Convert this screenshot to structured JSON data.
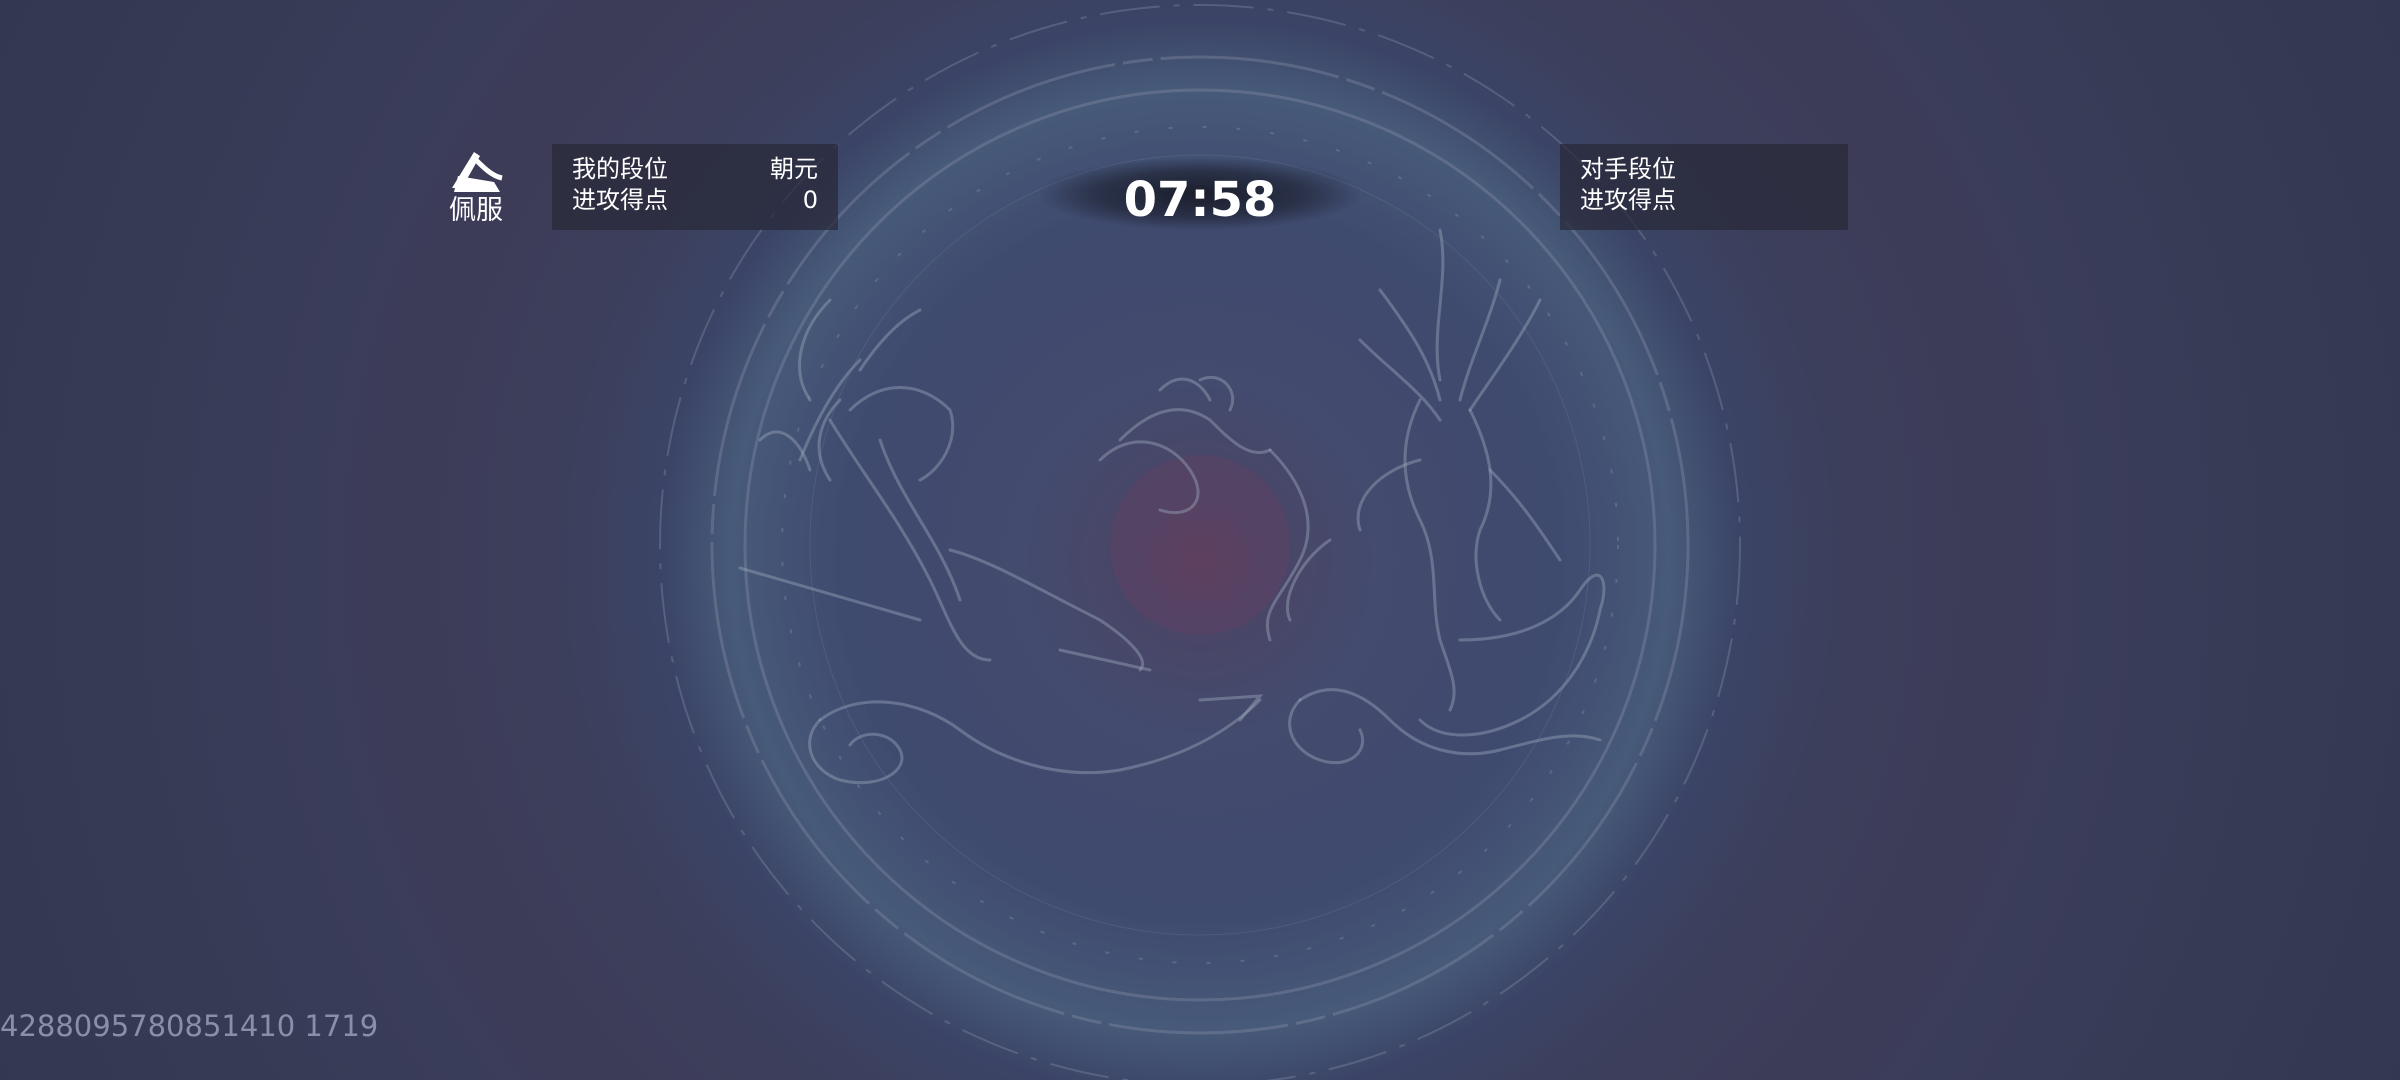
{
  "logo": {
    "text": "佩服",
    "icon": "handshake-icon"
  },
  "my_panel": {
    "rank_label": "我的段位",
    "rank_value": "朝元",
    "score_label": "进攻得点",
    "score_value": "0"
  },
  "timer": {
    "value": "07:58"
  },
  "opponent_panel": {
    "rank_label": "对手段位",
    "score_label": "进攻得点"
  },
  "uid": "4288095780851410 1719",
  "background": {
    "art": "dragon-mural-icon"
  },
  "colors": {
    "background": "#35384f",
    "panel": "#282838",
    "text": "#ffffff",
    "uid_text": "#8a8ea8"
  }
}
